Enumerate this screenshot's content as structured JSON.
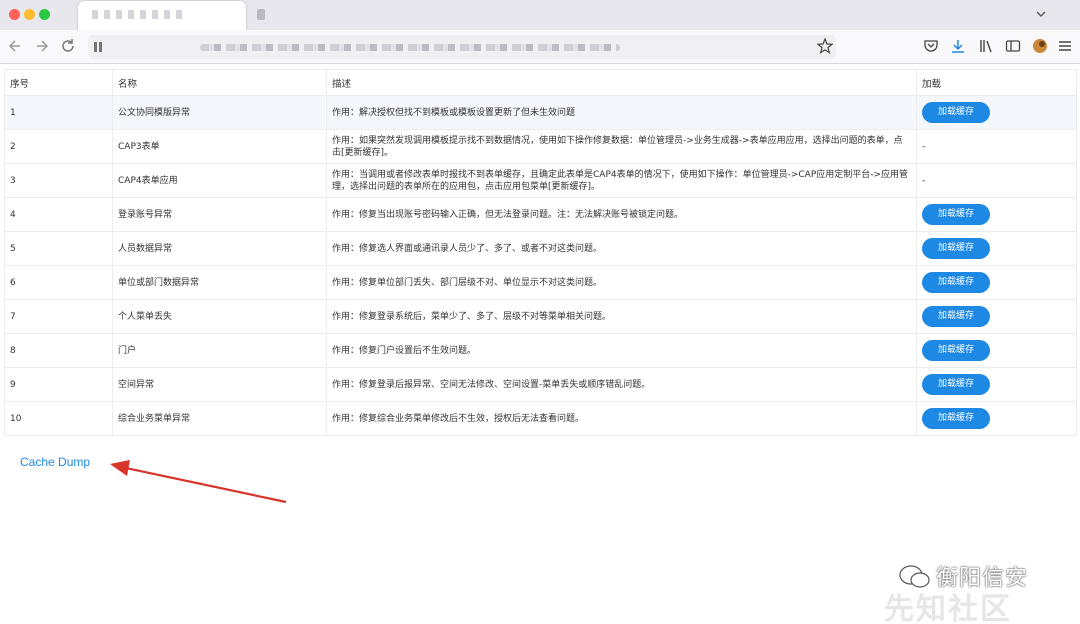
{
  "table": {
    "headers": [
      "序号",
      "名称",
      "描述",
      "加载"
    ],
    "button_label": "加载缓存",
    "rows": [
      {
        "no": "1",
        "name": "公文协同模版异常",
        "desc": "作用：解决授权但找不到模板或模板设置更新了但未生效问题",
        "action": "button"
      },
      {
        "no": "2",
        "name": "CAP3表单",
        "desc": "作用：如果突然发现调用模板提示找不到数据情况，使用如下操作修复数据：单位管理员->业务生成器->表单应用应用，选择出问题的表单，点击[更新缓存]。",
        "action": "-"
      },
      {
        "no": "3",
        "name": "CAP4表单应用",
        "desc": "作用：当调用或者修改表单时报找不到表单缓存，且确定此表单是CAP4表单的情况下，使用如下操作：单位管理员->CAP应用定制平台->应用管理，选择出问题的表单所在的应用包，点击应用包菜单[更新缓存]。",
        "action": "-"
      },
      {
        "no": "4",
        "name": "登录账号异常",
        "desc": "作用：修复当出现账号密码输入正确，但无法登录问题。注：无法解决账号被锁定问题。",
        "action": "button"
      },
      {
        "no": "5",
        "name": "人员数据异常",
        "desc": "作用：修复选人界面或通讯录人员少了、多了、或者不对这类问题。",
        "action": "button"
      },
      {
        "no": "6",
        "name": "单位或部门数据异常",
        "desc": "作用：修复单位部门丢失、部门层级不对、单位显示不对这类问题。",
        "action": "button"
      },
      {
        "no": "7",
        "name": "个人菜单丢失",
        "desc": "作用：修复登录系统后，菜单少了、多了、层级不对等菜单相关问题。",
        "action": "button"
      },
      {
        "no": "8",
        "name": "门户",
        "desc": "作用：修复门户设置后不生效问题。",
        "action": "button"
      },
      {
        "no": "9",
        "name": "空间异常",
        "desc": "作用：修复登录后报异常、空间无法修改、空间设置-菜单丢失或顺序错乱问题。",
        "action": "button"
      },
      {
        "no": "10",
        "name": "综合业务菜单异常",
        "desc": "作用：修复综合业务菜单修改后不生效，授权后无法查看问题。",
        "action": "button"
      }
    ]
  },
  "footer": {
    "cache_dump_link": "Cache Dump"
  },
  "watermark": {
    "text": "衡阳信安",
    "back_text": "先知社区"
  },
  "colors": {
    "accent": "#1e88e5",
    "arrow": "#d9342b"
  }
}
